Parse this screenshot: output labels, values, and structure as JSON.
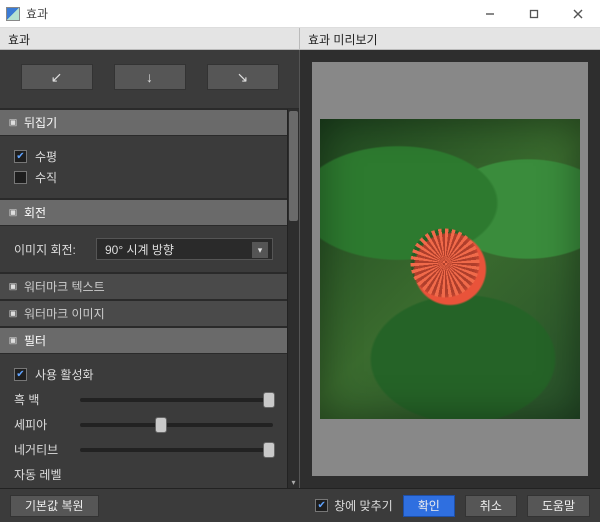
{
  "window": {
    "title": "효과"
  },
  "panels": {
    "effects_header": "효과",
    "preview_header": "효과 미리보기"
  },
  "sections": {
    "flip": {
      "title": "뒤집기",
      "expanded": true,
      "options": {
        "horizontal": {
          "label": "수평",
          "checked": true
        },
        "vertical": {
          "label": "수직",
          "checked": false
        }
      }
    },
    "rotate": {
      "title": "회전",
      "expanded": true,
      "label": "이미지 회전:",
      "value": "90° 시계 방향"
    },
    "wm_text": {
      "title": "워터마크 텍스트",
      "expanded": false
    },
    "wm_image": {
      "title": "워터마크 이미지",
      "expanded": false
    },
    "filter": {
      "title": "필터",
      "expanded": true,
      "enable": {
        "label": "사용 활성화",
        "checked": true
      },
      "sliders": {
        "bw": {
          "label": "흑 백",
          "value": 98
        },
        "sepia": {
          "label": "세피아",
          "value": 42
        },
        "negative": {
          "label": "네거티브",
          "value": 98
        },
        "auto": {
          "label": "자동 레벨",
          "value": null
        }
      }
    }
  },
  "footer": {
    "restore_defaults": "기본값 복원",
    "fit_window": {
      "label": "창에 맞추기",
      "checked": true
    },
    "ok": "확인",
    "cancel": "취소",
    "help": "도움말"
  },
  "colors": {
    "primary": "#2f6fe0",
    "panel": "#3b3b3b",
    "header": "#6a6a6a"
  }
}
